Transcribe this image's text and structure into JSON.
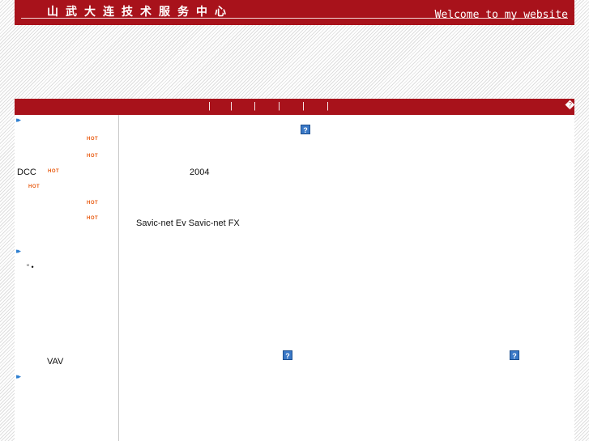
{
  "header": {
    "title": "山武大连技术服务中心",
    "welcome": "Welcome to my website"
  },
  "navbar": {
    "separators": [
      "|",
      "|",
      "|",
      "|",
      "|",
      "|"
    ],
    "corner_glyph": "�"
  },
  "sidebar": {
    "section_arrow": "▸▸",
    "hot_badge": "HOT",
    "items": [
      {
        "label": ""
      },
      {
        "label": ""
      },
      {
        "label": "DCC"
      },
      {
        "label": ""
      },
      {
        "label": ""
      },
      {
        "label": ""
      }
    ],
    "middle_text": "“ •",
    "vav_label": "VAV"
  },
  "content": {
    "help_glyph": "?",
    "year": "2004",
    "products": "Savic-net Ev  Savic-net FX"
  },
  "colors": {
    "brand_red": "#a8121b",
    "hot_orange": "#e85a10",
    "arrow_blue": "#2f7fd0",
    "help_blue": "#3a78c6"
  }
}
